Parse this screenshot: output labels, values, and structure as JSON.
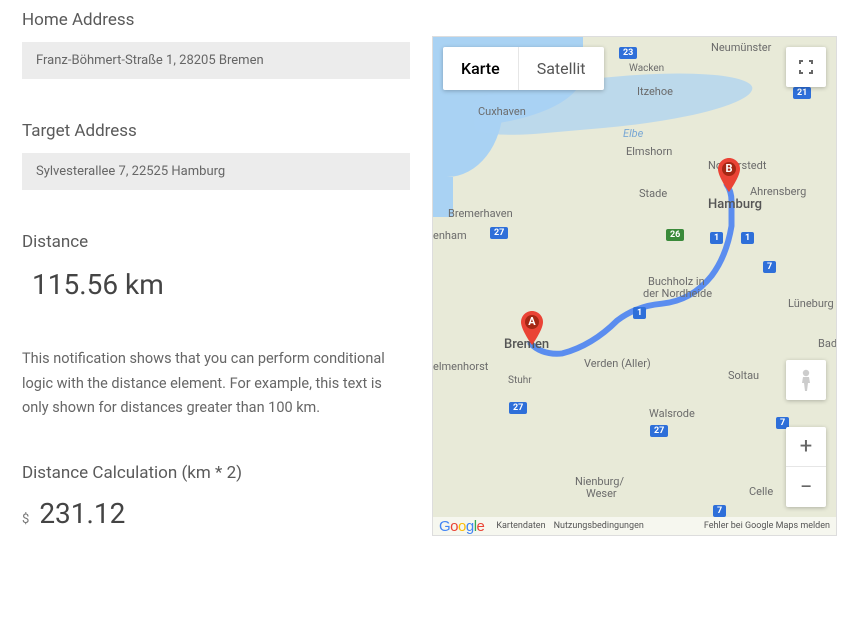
{
  "form": {
    "home_label": "Home Address",
    "home_value": "Franz-Böhmert-Straße 1, 28205 Bremen",
    "target_label": "Target Address",
    "target_value": "Sylvesterallee 7, 22525 Hamburg"
  },
  "distance": {
    "label": "Distance",
    "value": "115.56 km"
  },
  "notification": "This notification shows that you can perform conditional logic with the distance element. For example, this text is only shown for distances greater than 100 km.",
  "calculation": {
    "label": "Distance Calculation (km * 2)",
    "currency": "$",
    "value": "231.12"
  },
  "map": {
    "type_buttons": {
      "map": "Karte",
      "satellite": "Satellit"
    },
    "markers": {
      "a": "A",
      "b": "B"
    },
    "cities": {
      "neumunster": "Neumünster",
      "wacken": "Wacken",
      "itzehoe": "Itzehoe",
      "cuxhaven": "Cuxhaven",
      "elbe": "Elbe",
      "elmshorn": "Elmshorn",
      "norderstedt": "Norderstedt",
      "stade": "Stade",
      "ahrensberg": "Ahrensberg",
      "hamburg": "Hamburg",
      "bremerhaven": "Bremerhaven",
      "enham": "enham",
      "buchholz": "Buchholz in",
      "nordheide": "der Nordheide",
      "luneburg": "Lüneburg",
      "bremen": "Bremen",
      "elmenhorst": "elmenhorst",
      "stuhr": "Stuhr",
      "verden": "Verden (Aller)",
      "soltau": "Soltau",
      "bad": "Bad",
      "walsrode": "Walsrode",
      "nienburg": "Nienburg/",
      "weser": "Weser",
      "celle": "Celle"
    },
    "roads": {
      "a23": "23",
      "a21": "21",
      "a27a": "27",
      "a1a": "1",
      "a26": "26",
      "a7a": "7",
      "a1b": "1",
      "a1c": "1",
      "a7b": "7",
      "a27b": "27",
      "a27c": "27",
      "a7c": "7"
    },
    "attribution": {
      "kartendaten": "Kartendaten",
      "terms": "Nutzungsbedingungen",
      "report": "Fehler bei Google Maps melden"
    }
  }
}
